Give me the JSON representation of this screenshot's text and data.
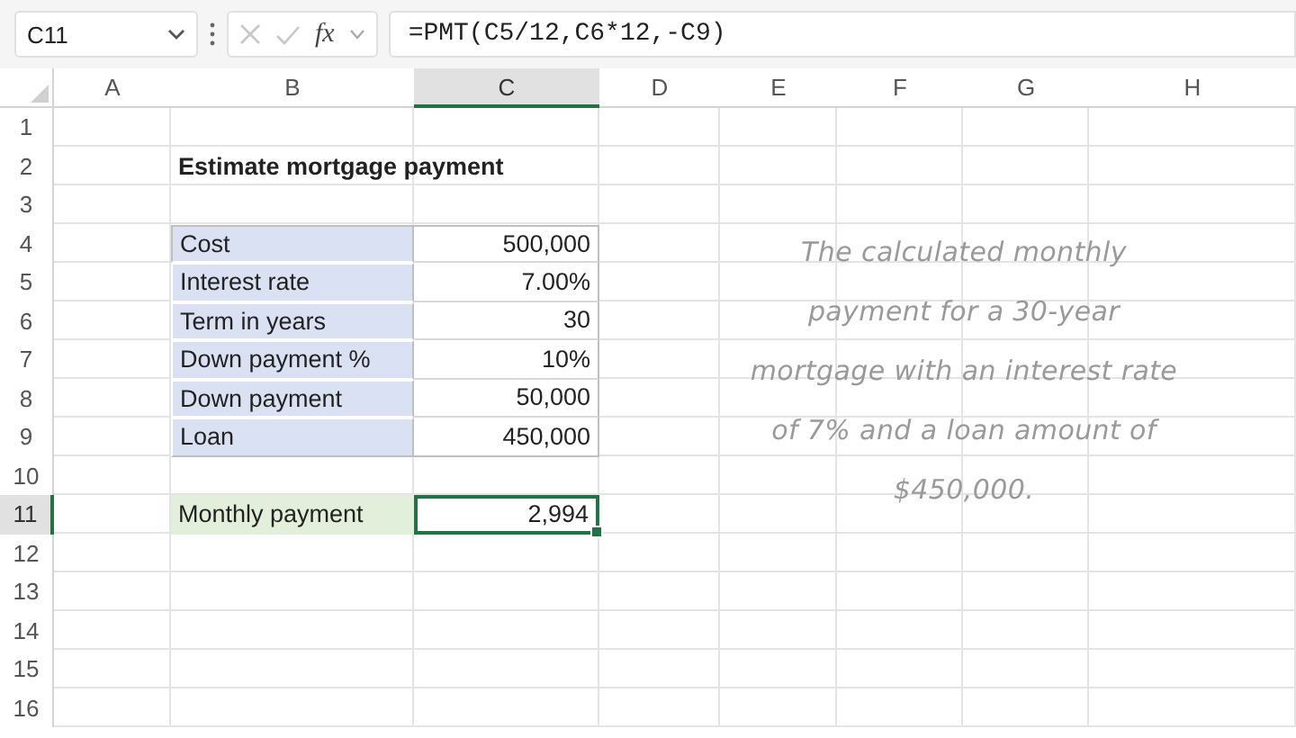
{
  "formula_bar": {
    "name_box": "C11",
    "fx": "fx",
    "formula": "=PMT(C5/12,C6*12,-C9)"
  },
  "columns": [
    {
      "label": "A",
      "selected": false
    },
    {
      "label": "B",
      "selected": false
    },
    {
      "label": "C",
      "selected": true
    },
    {
      "label": "D",
      "selected": false
    },
    {
      "label": "E",
      "selected": false
    },
    {
      "label": "F",
      "selected": false
    },
    {
      "label": "G",
      "selected": false
    },
    {
      "label": "H",
      "selected": false
    }
  ],
  "rows": [
    {
      "label": "1",
      "selected": false
    },
    {
      "label": "2",
      "selected": false
    },
    {
      "label": "3",
      "selected": false
    },
    {
      "label": "4",
      "selected": false
    },
    {
      "label": "5",
      "selected": false
    },
    {
      "label": "6",
      "selected": false
    },
    {
      "label": "7",
      "selected": false
    },
    {
      "label": "8",
      "selected": false
    },
    {
      "label": "9",
      "selected": false
    },
    {
      "label": "10",
      "selected": false
    },
    {
      "label": "11",
      "selected": true
    },
    {
      "label": "12",
      "selected": false
    },
    {
      "label": "13",
      "selected": false
    },
    {
      "label": "14",
      "selected": false
    },
    {
      "label": "15",
      "selected": false
    },
    {
      "label": "16",
      "selected": false
    }
  ],
  "title": "Estimate mortgage payment",
  "inputs": [
    {
      "label": "Cost",
      "value": "500,000"
    },
    {
      "label": "Interest rate",
      "value": "7.00%"
    },
    {
      "label": "Term in years",
      "value": "30"
    },
    {
      "label": "Down payment %",
      "value": "10%"
    },
    {
      "label": "Down payment",
      "value": "50,000"
    },
    {
      "label": "Loan",
      "value": "450,000"
    }
  ],
  "result": {
    "label": "Monthly payment",
    "value": "2,994",
    "selected": true
  },
  "note": "The calculated monthly payment for a 30-year mortgage with an interest rate of 7% and a loan amount of $450,000."
}
